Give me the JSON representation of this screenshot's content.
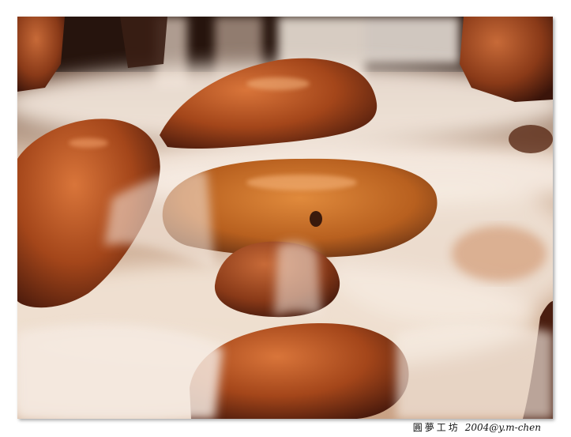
{
  "photo": {
    "subject": "waterfall-over-rocks",
    "palette": {
      "rock": "#b5541f",
      "rock_dark": "#4a1a0c",
      "water": "#f2e6da",
      "shadow": "#3a1e14"
    }
  },
  "caption": {
    "studio": "圓夢工坊",
    "copyright": "2004@y.m-chen"
  }
}
